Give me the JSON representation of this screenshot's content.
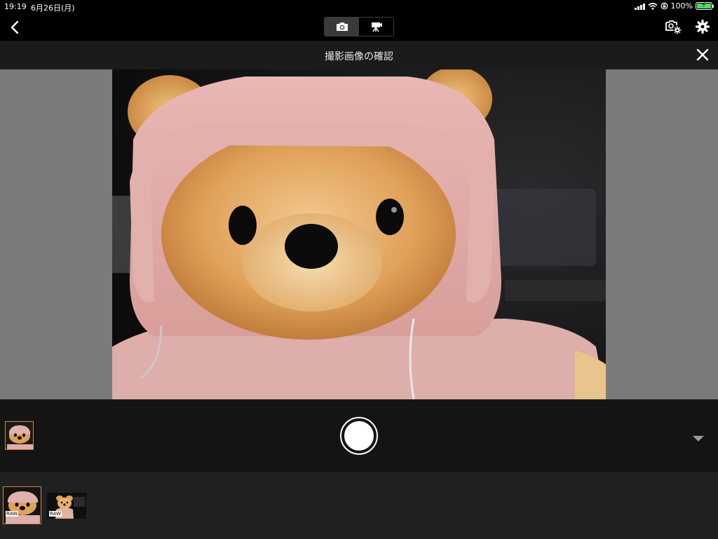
{
  "status_bar": {
    "time": "19:19",
    "date": "6月26日(月)",
    "battery": "100%"
  },
  "nav": {
    "back_icon": "chevron-left-icon",
    "modes": [
      {
        "name": "photo",
        "icon": "camera-icon",
        "active": true
      },
      {
        "name": "video",
        "icon": "movie-camera-icon",
        "active": false
      }
    ],
    "right_icons": [
      "camera-settings-icon",
      "gear-icon"
    ]
  },
  "title_bar": {
    "title": "撮影画像の確認",
    "close_icon": "close-icon"
  },
  "preview": {
    "subject": "teddy-bear-in-pink-hoodie"
  },
  "capture_bar": {
    "shutter_icon": "shutter-button",
    "expand_icon": "triangle-down-icon"
  },
  "strip": {
    "items": [
      {
        "badge": "RAW",
        "selected": true
      },
      {
        "badge": "RAW",
        "selected": false
      }
    ]
  },
  "colors": {
    "accent": "#d08a3a",
    "battery": "#4cd964",
    "title_bg": "#1b1b1b",
    "preview_bg": "#7b7b7b"
  }
}
